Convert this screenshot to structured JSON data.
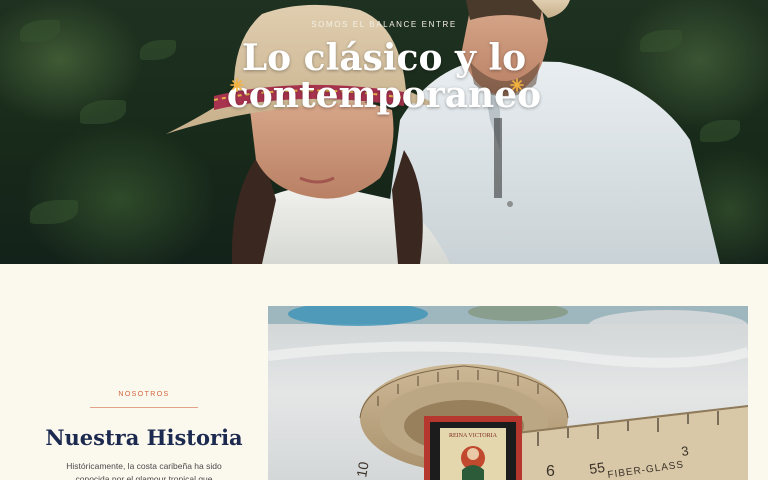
{
  "hero": {
    "eyebrow": "SOMOS EL BALANCE ENTRE",
    "title_line1": "Lo clásico y lo",
    "title_line2": "contemporaneo",
    "accent_color": "#f4b23e"
  },
  "about": {
    "eyebrow": "NOSOTROS",
    "title": "Nuestra Historia",
    "text": "Históricamente, la costa caribeña ha sido conocida por el glamour tropical que",
    "accent_color": "#d2643c",
    "title_color": "#1c2a4f"
  },
  "photo_labels": {
    "card_text": "REINA VICTORIA",
    "tape_mark_1": "10",
    "tape_mark_2": "6",
    "tape_mark_3": "55",
    "tape_mark_4": "3",
    "tape_brand": "FIBER-GLASS"
  }
}
